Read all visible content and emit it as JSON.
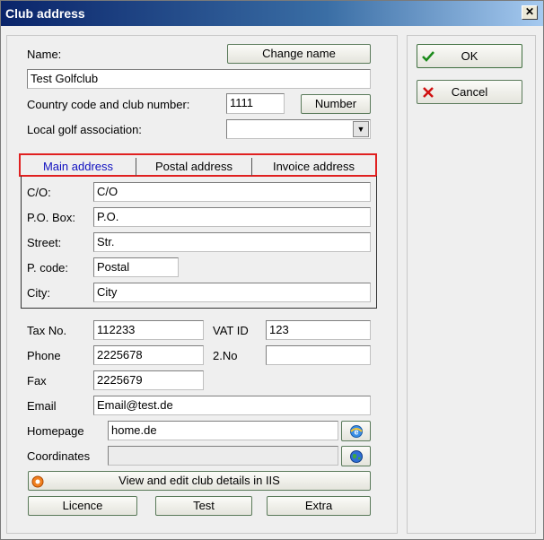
{
  "window": {
    "title": "Club address",
    "close_glyph": "✕"
  },
  "form": {
    "name_label": "Name:",
    "name_value": "Test Golfclub",
    "change_name_button": "Change name",
    "country_label": "Country code and club number:",
    "country_value": "1111",
    "number_button": "Number",
    "association_label": "Local golf association:",
    "association_value": ""
  },
  "tabs": [
    {
      "label": "Main address",
      "active": true
    },
    {
      "label": "Postal address",
      "active": false
    },
    {
      "label": "Invoice address",
      "active": false
    }
  ],
  "address": {
    "co_label": "C/O:",
    "co_value": "C/O",
    "pobox_label": "P.O. Box:",
    "pobox_value": "P.O.",
    "street_label": "Street:",
    "street_value": "Str.",
    "pcode_label": "P. code:",
    "pcode_value": "Postal",
    "city_label": "City:",
    "city_value": "City"
  },
  "details": {
    "taxno_label": "Tax No.",
    "taxno_value": "112233",
    "vatid_label": "VAT ID",
    "vatid_value": "123",
    "phone_label": "Phone",
    "phone_value": "2225678",
    "no2_label": "2.No",
    "no2_value": "",
    "fax_label": "Fax",
    "fax_value": "2225679",
    "email_label": "Email",
    "email_value": "Email@test.de",
    "homepage_label": "Homepage",
    "homepage_value": "home.de",
    "coordinates_label": "Coordinates",
    "coordinates_value": ""
  },
  "buttons": {
    "view_edit": "View and edit club details in IIS",
    "licence": "Licence",
    "test": "Test",
    "extra": "Extra",
    "ok": "OK",
    "cancel": "Cancel"
  },
  "colors": {
    "tab_highlight": "#e02020",
    "active_tab_text": "#1010c0"
  }
}
